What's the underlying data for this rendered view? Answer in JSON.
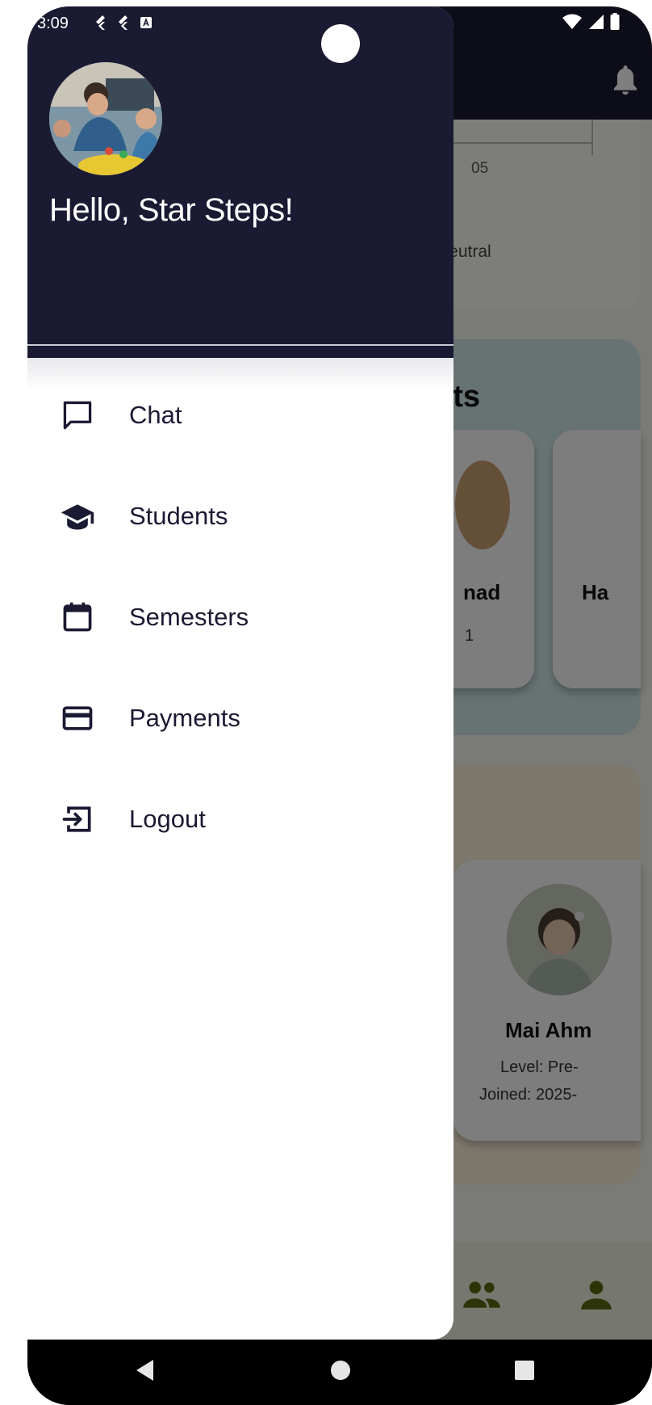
{
  "status_bar": {
    "time": "3:09",
    "left_icons": [
      "flutter-icon",
      "flutter-icon",
      "a-box-icon"
    ],
    "right_icons": [
      "wifi-icon",
      "signal-icon",
      "battery-icon"
    ]
  },
  "drawer": {
    "greeting": "Hello, Star Steps!",
    "header_color": "#1b1a33",
    "menu": [
      {
        "label": "Chat",
        "icon": "chat-icon"
      },
      {
        "label": "Students",
        "icon": "graduation-cap-icon"
      },
      {
        "label": "Semesters",
        "icon": "calendar-icon"
      },
      {
        "label": "Payments",
        "icon": "credit-card-icon"
      },
      {
        "label": "Logout",
        "icon": "logout-icon"
      }
    ]
  },
  "background_app": {
    "chart_x_label": "05",
    "chart_legend": "Neutral",
    "students_title_fragment": "nts",
    "student_card_1": {
      "name_fragment": "nad",
      "sub_fragment": "1"
    },
    "student_card_2": {
      "name_fragment": "Ha"
    },
    "newcomer": {
      "name": "Mai Ahm",
      "level": "Level: Pre-",
      "joined": "Joined: 2025-"
    },
    "nav_icons": [
      "people-icon",
      "person-icon"
    ]
  },
  "system_nav": {
    "buttons": [
      "back-icon",
      "home-icon",
      "recents-icon"
    ]
  }
}
